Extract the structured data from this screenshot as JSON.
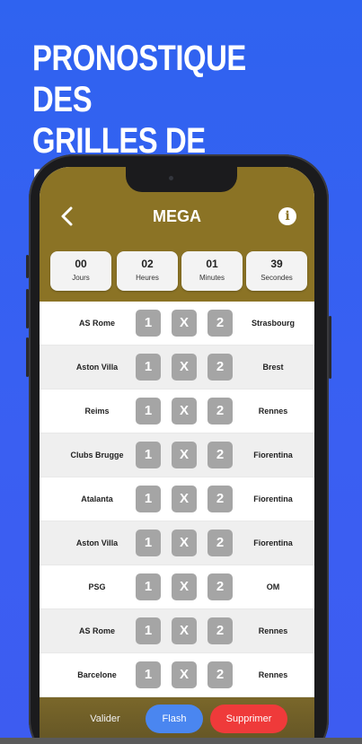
{
  "headline": {
    "line1": "PRONOSTIQUE DES",
    "line2": "GRILLES DE MATCHS"
  },
  "app": {
    "title": "MEGA",
    "back_icon": "chevron-left-icon",
    "info_icon": "info-icon",
    "info_glyph": "i"
  },
  "countdown": [
    {
      "value": "00",
      "unit": "Jours"
    },
    {
      "value": "02",
      "unit": "Heures"
    },
    {
      "value": "01",
      "unit": "Minutes"
    },
    {
      "value": "39",
      "unit": "Secondes"
    }
  ],
  "pick_labels": {
    "one": "1",
    "draw": "X",
    "two": "2"
  },
  "matches": [
    {
      "home": "AS Rome",
      "away": "Strasbourg"
    },
    {
      "home": "Aston Villa",
      "away": "Brest"
    },
    {
      "home": "Reims",
      "away": "Rennes"
    },
    {
      "home": "Clubs Brugge",
      "away": "Fiorentina"
    },
    {
      "home": "Atalanta",
      "away": "Fiorentina"
    },
    {
      "home": "Aston Villa",
      "away": "Fiorentina"
    },
    {
      "home": "PSG",
      "away": "OM"
    },
    {
      "home": "AS Rome",
      "away": "Rennes"
    },
    {
      "home": "Barcelone",
      "away": "Rennes"
    }
  ],
  "actions": {
    "validate": "Valider",
    "flash": "Flash",
    "delete": "Supprimer"
  },
  "colors": {
    "background": "#3a5ff2",
    "gold": "#8b7325",
    "pick_button": "#a5a5a5",
    "flash": "#4a86f0",
    "delete": "#ef3a3a"
  }
}
